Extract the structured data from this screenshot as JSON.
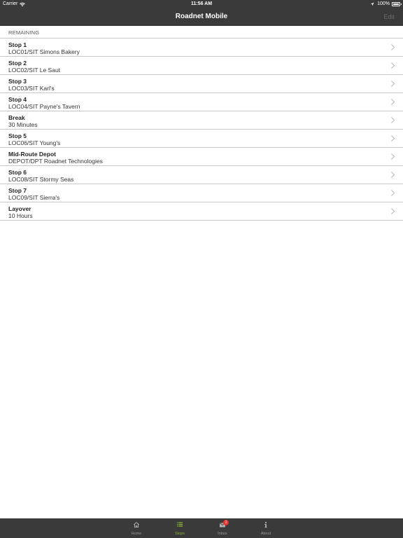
{
  "status_bar": {
    "carrier": "Carrier",
    "time": "11:56 AM",
    "battery": "100%"
  },
  "nav": {
    "title": "Roadnet Mobile",
    "edit_label": "Edit"
  },
  "section": {
    "header": "REMAINING"
  },
  "stops": [
    {
      "title": "Stop 1",
      "subtitle": "LOC01/SIT Simons Bakery"
    },
    {
      "title": "Stop 2",
      "subtitle": "LOC02/SIT Le Saut"
    },
    {
      "title": "Stop 3",
      "subtitle": "LOC03/SIT Karl's"
    },
    {
      "title": "Stop 4",
      "subtitle": "LOC04/SIT Payne's Tavern"
    },
    {
      "title": "Break",
      "subtitle": "30 Minutes"
    },
    {
      "title": "Stop 5",
      "subtitle": "LOC06/SIT Young's"
    },
    {
      "title": "Mid-Route Depot",
      "subtitle": "DEPOT/DPT Roadnet Technologies"
    },
    {
      "title": "Stop 6",
      "subtitle": "LOC08/SIT Stormy Seas"
    },
    {
      "title": "Stop 7",
      "subtitle": "LOC09/SIT Sierra's"
    },
    {
      "title": "Layover",
      "subtitle": "10 Hours"
    }
  ],
  "tabs": [
    {
      "label": "Home",
      "icon": "home-icon"
    },
    {
      "label": "Stops",
      "icon": "list-icon"
    },
    {
      "label": "Inbox",
      "icon": "inbox-icon",
      "badge": "1"
    },
    {
      "label": "About",
      "icon": "info-icon"
    }
  ],
  "colors": {
    "bar_background": "#3a3a3a",
    "active_tab": "#8ab133",
    "badge": "#e8322d"
  }
}
